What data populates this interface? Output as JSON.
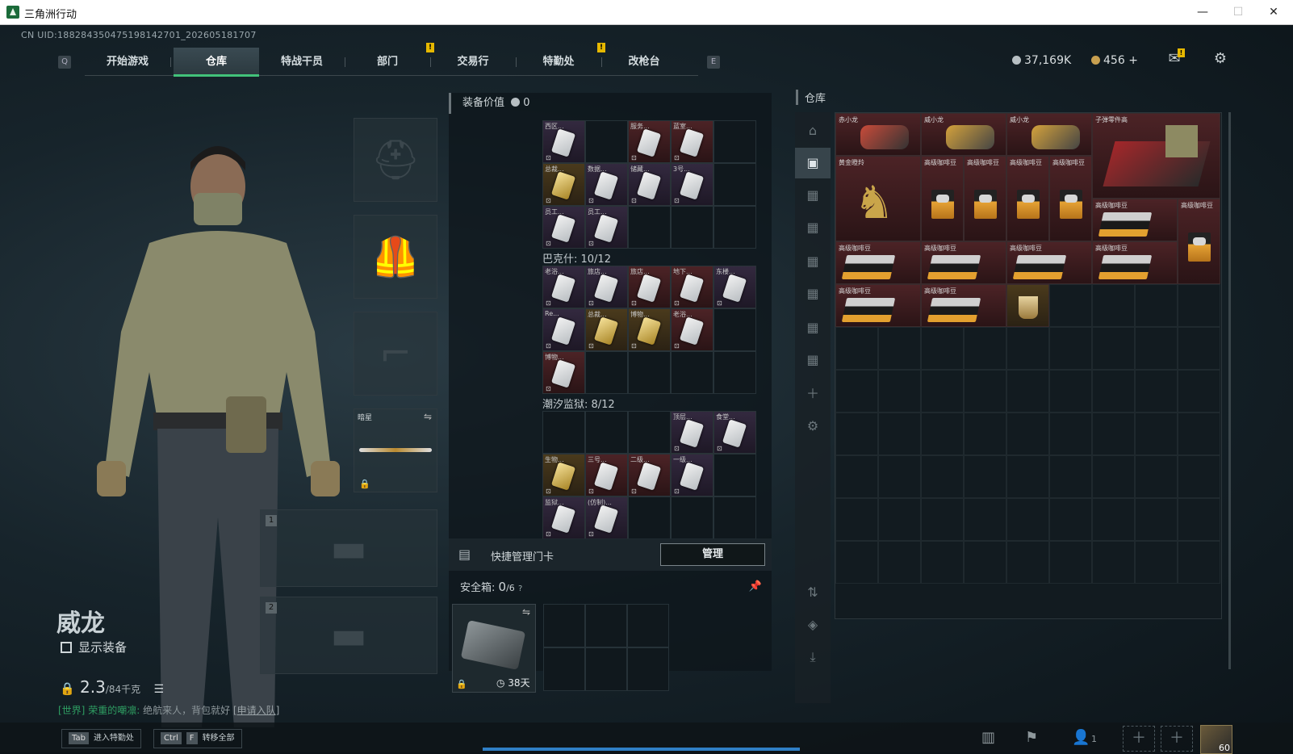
{
  "window": {
    "title": "三角洲行动",
    "min": "—",
    "max": "☐",
    "close": "✕"
  },
  "uid": "CN UID:1882843504751981427​01_202605181707",
  "nav": {
    "left_key": "Q",
    "right_key": "E",
    "tabs": [
      {
        "label": "开始游戏"
      },
      {
        "label": "仓库",
        "active": true
      },
      {
        "label": "特战干员"
      },
      {
        "label": "部门"
      },
      {
        "label": "交易行"
      },
      {
        "label": "特勤处"
      },
      {
        "label": "改枪台"
      }
    ],
    "alert": "!"
  },
  "currency": {
    "silver": "37,169K",
    "gold": "456",
    "plus": "+"
  },
  "operator": {
    "name": "威龙",
    "show_equipment": "显示装备",
    "weight_value": "2.3",
    "weight_cap": "/84千克",
    "melee_label": "暗星",
    "slot1": "1",
    "slot2": "2"
  },
  "chat": {
    "channel": "[世界]",
    "user": "荣重的嘲凛:",
    "message": "绝航来人，背包就好",
    "join": "[申请入队]"
  },
  "bottom": {
    "hint1_key": "Tab",
    "hint1_label": "进入特勤处",
    "hint2_key1": "Ctrl",
    "hint2_key2": "F",
    "hint2_label": "转移全部",
    "friends": "1",
    "level": "60"
  },
  "equipment": {
    "title": "装备价值",
    "value": "0",
    "sections": [
      {
        "label": "巴克什: 10/12"
      },
      {
        "label": "潮汐监狱: 8/12"
      }
    ],
    "keycards_top": [
      "西区...",
      "",
      "服务...",
      "蓝室...",
      "",
      "总裁...",
      "数据...",
      "储藏...",
      "3号...",
      "",
      "员工...",
      "员工..."
    ],
    "keycards_bakesh": [
      "老浴...",
      "旅店...",
      "旅店...",
      "地下...",
      "东楼...",
      "Re...",
      "总裁...",
      "博物...",
      "老浴...",
      "",
      "博物..."
    ],
    "keycards_tide": [
      "",
      "",
      "",
      "顶层...",
      "食堂...",
      "生物...",
      "三号...",
      "二级...",
      "一级...",
      "",
      "监狱...",
      "(仿制)..."
    ],
    "quick_manage": "快捷管理门卡",
    "manage_btn": "管理",
    "safe_title": "安全箱:",
    "safe_count": "0",
    "safe_cap": "/6",
    "safe_help": "?",
    "safe_days": "38天"
  },
  "warehouse": {
    "title": "仓库",
    "items": [
      {
        "label": "赤小龙"
      },
      {
        "label": "威小龙"
      },
      {
        "label": "威小龙"
      },
      {
        "label": "子弹零件高"
      },
      {
        "label": "黄金瞪羚"
      },
      {
        "label": "高级咖啡豆"
      }
    ]
  },
  "colors": {
    "accent": "#42c27a",
    "alert": "#e6b800",
    "progress": "#2f7fc6"
  }
}
